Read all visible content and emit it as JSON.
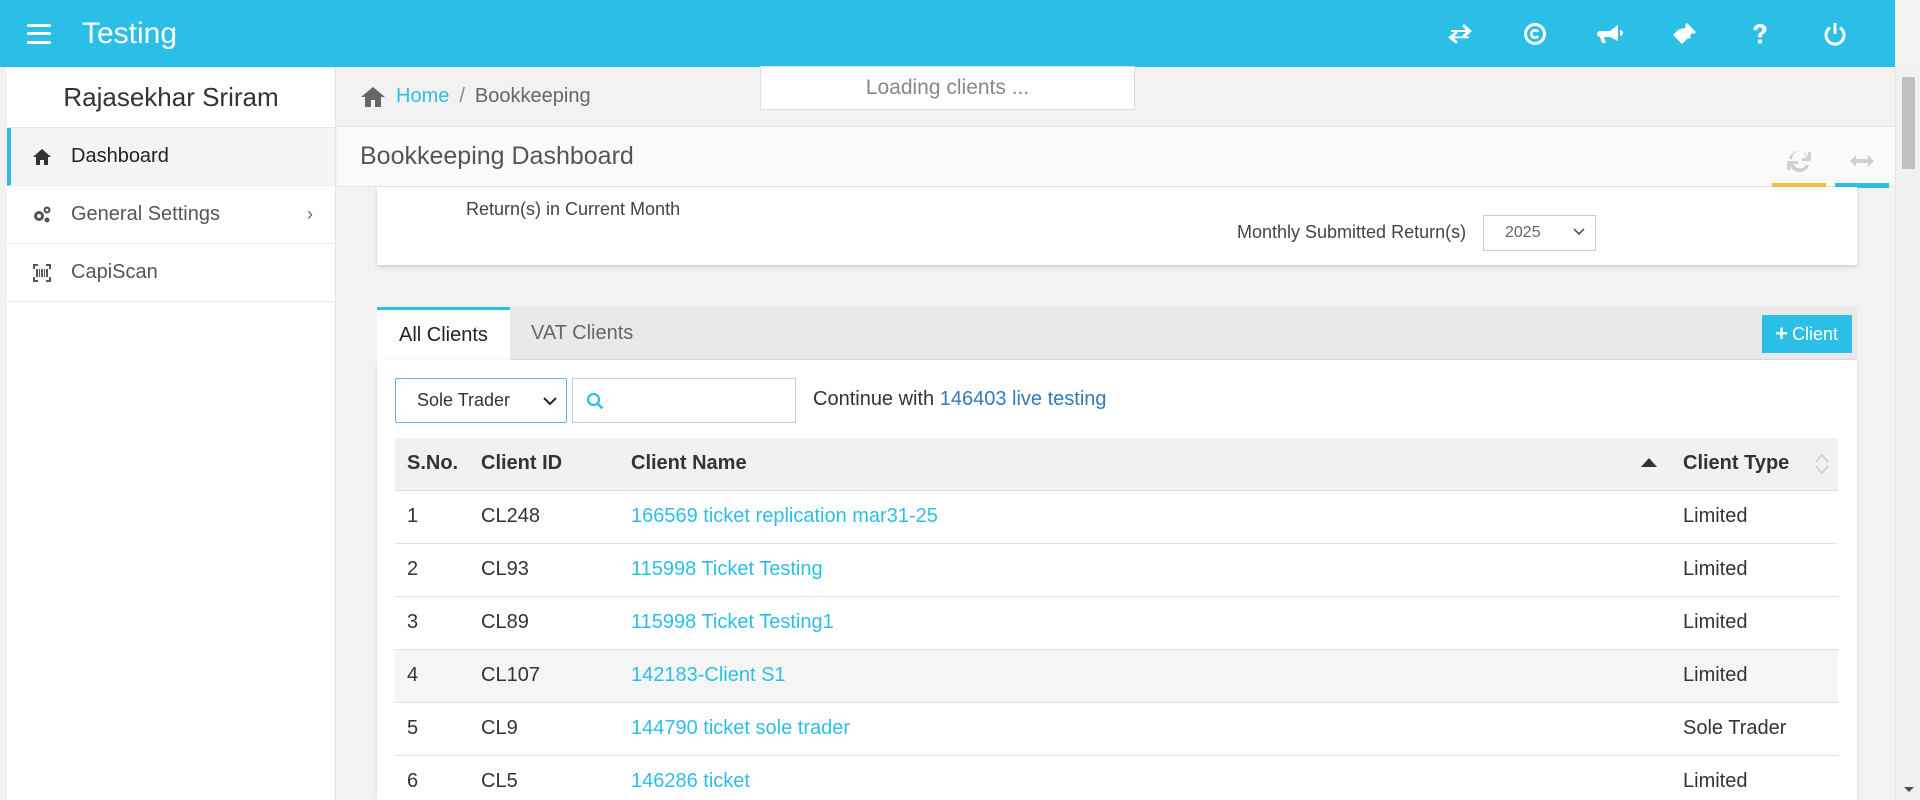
{
  "app": {
    "title": "Testing"
  },
  "topbar": {
    "icons": [
      "exchange-icon",
      "copyright-icon",
      "bullhorn-icon",
      "ticket-icon",
      "help-icon",
      "power-icon"
    ]
  },
  "loading": {
    "text": "Loading clients ..."
  },
  "sidebar": {
    "user_name": "Rajasekhar Sriram",
    "items": [
      {
        "label": "Dashboard",
        "icon": "home-icon",
        "active": true
      },
      {
        "label": "General Settings",
        "icon": "cogs-icon",
        "chevron": "›"
      },
      {
        "label": "CapiScan",
        "icon": "barcode-icon"
      }
    ]
  },
  "breadcrumb": {
    "home": "Home",
    "separator": "/",
    "current": "Bookkeeping"
  },
  "header": {
    "title": "Bookkeeping Dashboard"
  },
  "summary": {
    "returns_label": "Return(s) in Current Month",
    "monthly_label": "Monthly Submitted Return(s)",
    "year": "2025"
  },
  "tabs": [
    {
      "label": "All Clients",
      "active": true
    },
    {
      "label": "VAT Clients"
    }
  ],
  "add_client": {
    "label": "Client"
  },
  "filters": {
    "client_type": "Sole Trader",
    "search_placeholder": "",
    "continue_prefix": "Continue with",
    "continue_link": "146403 live testing"
  },
  "table": {
    "columns": [
      "S.No.",
      "Client ID",
      "Client Name",
      "Client Type"
    ],
    "rows": [
      {
        "sno": "1",
        "id": "CL248",
        "name": "166569 ticket replication mar31-25",
        "type": "Limited"
      },
      {
        "sno": "2",
        "id": "CL93",
        "name": "115998 Ticket Testing",
        "type": "Limited"
      },
      {
        "sno": "3",
        "id": "CL89",
        "name": "115998 Ticket Testing1",
        "type": "Limited"
      },
      {
        "sno": "4",
        "id": "CL107",
        "name": "142183-Client S1",
        "type": "Limited"
      },
      {
        "sno": "5",
        "id": "CL9",
        "name": "144790 ticket sole trader",
        "type": "Sole Trader"
      },
      {
        "sno": "6",
        "id": "CL5",
        "name": "146286 ticket",
        "type": "Limited"
      }
    ]
  },
  "colors": {
    "accent": "#2bbfe8",
    "link": "#337ab7",
    "refresh_bar": "#f0c040",
    "expand_bar": "#2bbfe8"
  }
}
